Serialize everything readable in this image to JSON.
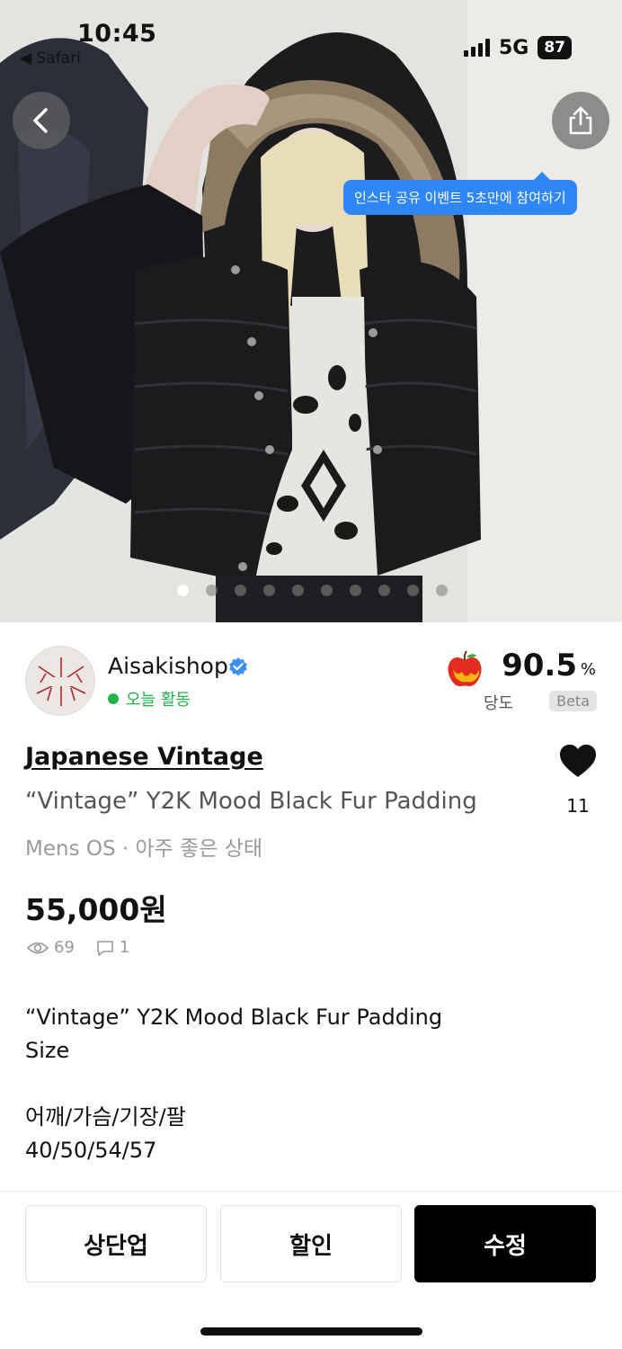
{
  "status_bar": {
    "time": "10:45",
    "back_app": "◀ Safari",
    "network": "5G",
    "battery": "87"
  },
  "hero": {
    "promo_tooltip": "인스타 공유 이벤트 5초만에 참여하기",
    "dot_count": 10,
    "active_dot": 0
  },
  "seller": {
    "name": "Aisakishop",
    "status": "오늘 활동"
  },
  "rating": {
    "value": "90.5",
    "unit": "%",
    "label": "당도",
    "badge": "Beta"
  },
  "product": {
    "brand": "Japanese Vintage",
    "title": "“Vintage” Y2K Mood Black Fur Padding",
    "meta": "Mens OS · 아주 좋은 상태",
    "price": "55,000원",
    "likes": "11",
    "views": "69",
    "comments": "1",
    "description": [
      "“Vintage” Y2K Mood Black Fur Padding",
      "Size",
      "",
      "어깨/가슴/기장/팔",
      "40/50/54/57"
    ]
  },
  "actions": {
    "bump": "상단업",
    "discount": "할인",
    "edit": "수정"
  },
  "colors": {
    "accent_blue": "#2f86f6",
    "active_green": "#22b24c",
    "primary_button": "#000000"
  }
}
